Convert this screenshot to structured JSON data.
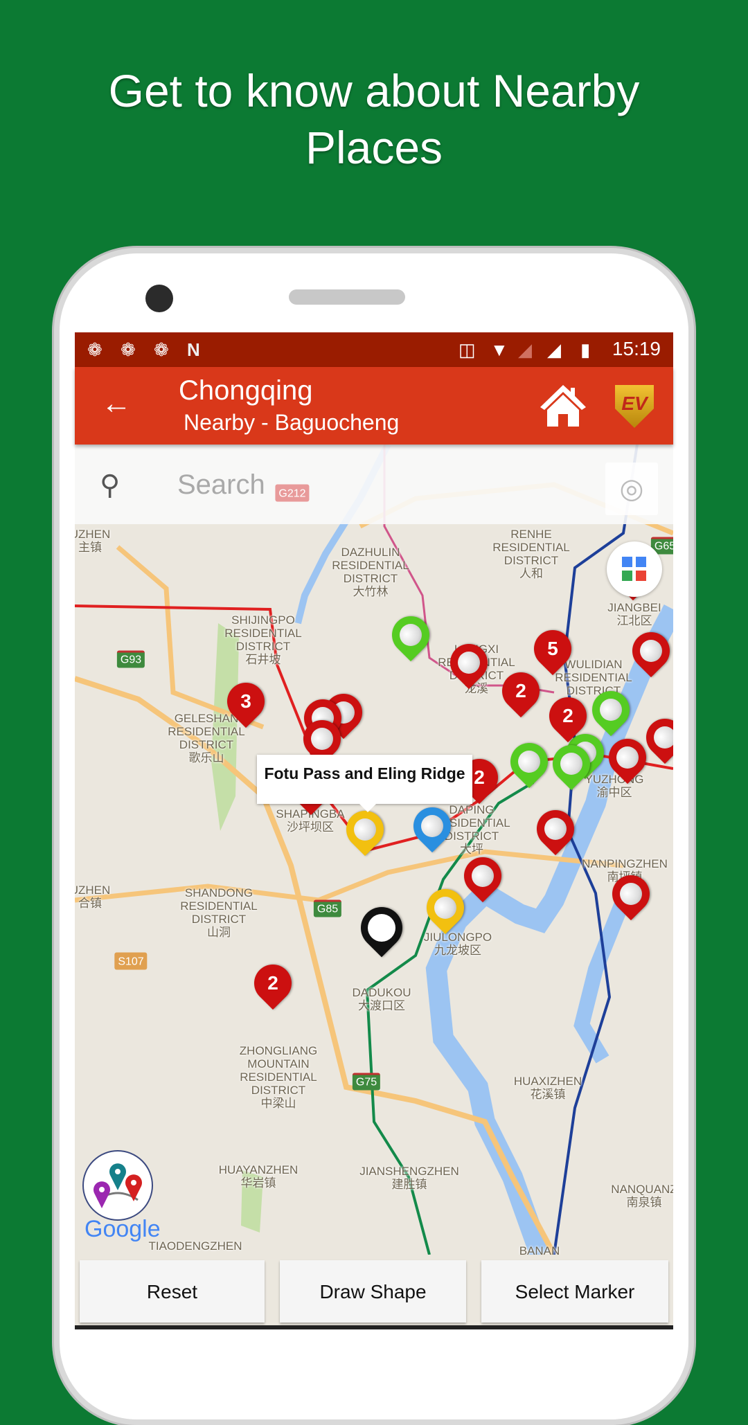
{
  "headline": {
    "line1": "Get to know about Nearby",
    "line2": "Places"
  },
  "status_bar": {
    "time": "15:19",
    "left_icons": [
      "aperture-icon",
      "aperture-icon",
      "aperture-icon",
      "n-icon"
    ],
    "right_icons": [
      "cast-icon",
      "wifi-icon",
      "signal-empty-icon",
      "signal-icon",
      "battery-charging-icon"
    ]
  },
  "app_bar": {
    "title": "Chongqing",
    "subtitle": "Nearby - Baguocheng",
    "ev_logo": "EV",
    "color": "#d9381a"
  },
  "search": {
    "placeholder": "Search"
  },
  "map": {
    "labels": [
      "UZHEN\n主镇",
      "DAZHULIN\nRESIDENTIAL\nDISTRICT\n大竹林",
      "RENHE\nRESIDENTIAL\nDISTRICT\n人和",
      "JIANGBEI\n江北区",
      "SHIJINGPO\nRESIDENTIAL\nDISTRICT\n石井坡",
      "LONGXI\nRESIDENTIAL\nDISTRICT\n龙溪",
      "WULIDIAN\nRESIDENTIAL\nDISTRICT",
      "GELESHAN\nRESIDENTIAL\nDISTRICT\n歌乐山",
      "SHAPINGBA\n沙坪坝区",
      "DAPING\nRESIDENTIAL\nDISTRICT\n大坪",
      "YUZHONG\n渝中区",
      "NANPINGZHEN\n南坪镇",
      "SHANDONG\nRESIDENTIAL\nDISTRICT\n山洞",
      "JIULONGPO\n九龙坡区",
      "DADUKOU\n大渡口区",
      "ZHONGLIANG\nMOUNTAIN\nRESIDENTIAL\nDISTRICT\n中梁山",
      "HUAXIZHEN\n花溪镇",
      "HUAYANZHEN\n华岩镇",
      "JIANSHENGZHEN\n建胜镇",
      "NANQUANZ\n南泉镇",
      "TIAODENGZHEN",
      "BANAN",
      "UZHEN\n合镇"
    ],
    "road_shields": [
      "G212",
      "G93",
      "G85",
      "S107",
      "G75",
      "G65"
    ],
    "clusters": [
      "3",
      "5",
      "2",
      "2",
      "2",
      "2"
    ],
    "tooltip": "Fotu Pass and Eling Ridge",
    "attribution": "Google"
  },
  "buttons": {
    "reset": "Reset",
    "draw_shape": "Draw Shape",
    "select_marker": "Select Marker"
  }
}
